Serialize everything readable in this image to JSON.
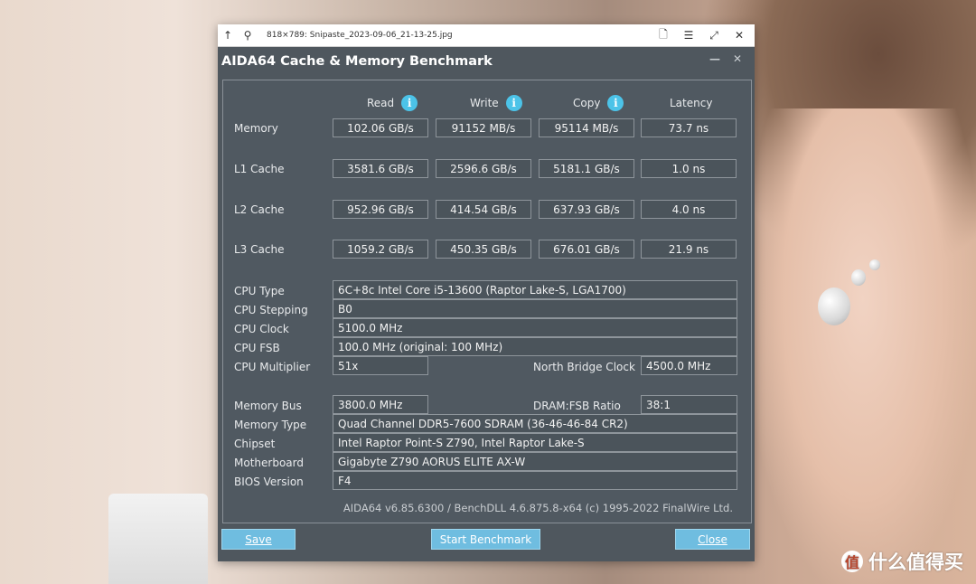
{
  "viewer": {
    "title": "818×789: Snipaste_2023-09-06_21-13-25.jpg",
    "icons": [
      "up-arrow-icon",
      "pin-icon",
      "document-icon",
      "list-icon",
      "expand-icon",
      "close-icon"
    ]
  },
  "window": {
    "title": "AIDA64 Cache & Memory Benchmark"
  },
  "columns": {
    "read": "Read",
    "write": "Write",
    "copy": "Copy",
    "latency": "Latency",
    "info_glyph": "i"
  },
  "rows": [
    {
      "label": "Memory",
      "read": "102.06 GB/s",
      "write": "91152 MB/s",
      "copy": "95114 MB/s",
      "latency": "73.7 ns"
    },
    {
      "label": "L1 Cache",
      "read": "3581.6 GB/s",
      "write": "2596.6 GB/s",
      "copy": "5181.1 GB/s",
      "latency": "1.0 ns"
    },
    {
      "label": "L2 Cache",
      "read": "952.96 GB/s",
      "write": "414.54 GB/s",
      "copy": "637.93 GB/s",
      "latency": "4.0 ns"
    },
    {
      "label": "L3 Cache",
      "read": "1059.2 GB/s",
      "write": "450.35 GB/s",
      "copy": "676.01 GB/s",
      "latency": "21.9 ns"
    }
  ],
  "cpu": {
    "type_label": "CPU Type",
    "type_value": "6C+8c Intel Core i5-13600  (Raptor Lake-S, LGA1700)",
    "stepping_label": "CPU Stepping",
    "stepping_value": "B0",
    "clock_label": "CPU Clock",
    "clock_value": "5100.0 MHz",
    "fsb_label": "CPU FSB",
    "fsb_value": "100.0 MHz  (original: 100 MHz)",
    "multiplier_label": "CPU Multiplier",
    "multiplier_value": "51x",
    "nb_clock_label": "North Bridge Clock",
    "nb_clock_value": "4500.0 MHz"
  },
  "memory": {
    "bus_label": "Memory Bus",
    "bus_value": "3800.0 MHz",
    "ratio_label": "DRAM:FSB Ratio",
    "ratio_value": "38:1",
    "type_label": "Memory Type",
    "type_value": "Quad Channel DDR5-7600 SDRAM  (36-46-46-84 CR2)",
    "chipset_label": "Chipset",
    "chipset_value": "Intel Raptor Point-S Z790, Intel Raptor Lake-S",
    "motherboard_label": "Motherboard",
    "motherboard_value": "Gigabyte Z790 AORUS ELITE AX-W",
    "bios_label": "BIOS Version",
    "bios_value": "F4"
  },
  "footer": "AIDA64 v6.85.6300 / BenchDLL 4.6.875.8-x64  (c) 1995-2022 FinalWire Ltd.",
  "buttons": {
    "save": "Save",
    "start": "Start Benchmark",
    "close": "Close"
  },
  "watermark": {
    "glyph": "值",
    "text": "什么值得买"
  }
}
